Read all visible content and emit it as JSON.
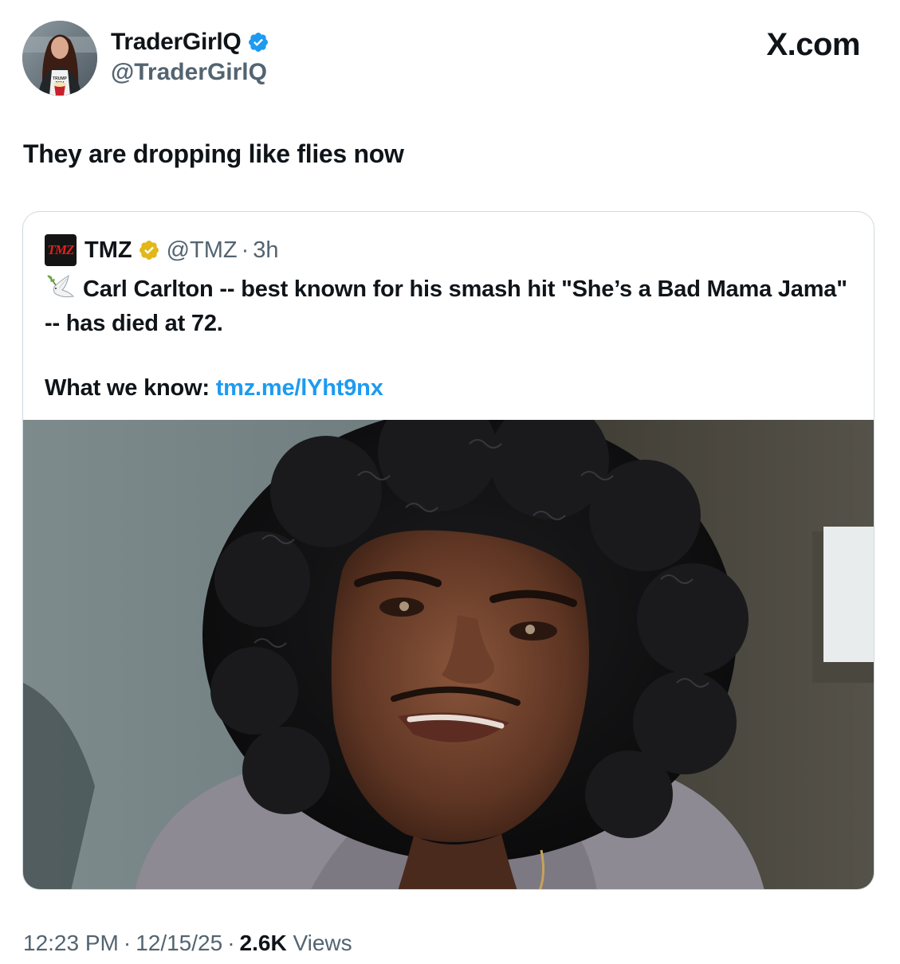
{
  "author": {
    "display_name": "TraderGirlQ",
    "handle": "@TraderGirlQ",
    "verified_badge": "blue-verified-badge-icon",
    "avatar_shirt_text": "TRUMP 2024"
  },
  "brand": {
    "site": "X.com"
  },
  "tweet": {
    "text": "They are dropping like flies now"
  },
  "quote": {
    "logo_text": "TMZ",
    "name": "TMZ",
    "verified_badge": "gold-verified-badge-icon",
    "handle": "@TMZ",
    "separator": "·",
    "time": "3h",
    "emoji": "dove-icon",
    "text_line1": "Carl Carlton -- best known for his smash hit \"She’s a Bad Mama Jama\" -- has died at 72.",
    "what_we_know_label": "What we know: ",
    "link": "tmz.me/lYht9nx"
  },
  "footer": {
    "time": "12:23 PM",
    "date": "12/15/25",
    "separator": "·",
    "views_count": "2.6K",
    "views_label": "Views"
  },
  "colors": {
    "text": "#0f1419",
    "secondary": "#536471",
    "link": "#1d9bf0",
    "verified_blue": "#1d9bf0",
    "verified_gold": "#e2b719",
    "border": "#cfd9de"
  }
}
